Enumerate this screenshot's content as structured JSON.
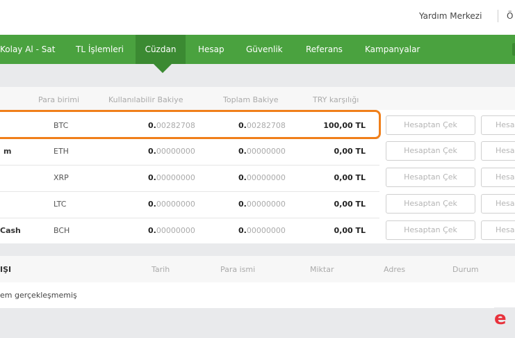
{
  "header": {
    "help_link": "Yardım Merkezi",
    "cut_link": "Ö"
  },
  "nav": {
    "items": [
      "Kolay Al - Sat",
      "TL İşlemleri",
      "Cüzdan",
      "Hesap",
      "Güvenlik",
      "Referans",
      "Kampanyalar"
    ],
    "active_index": 2
  },
  "wallet": {
    "columns": [
      "Para birimi",
      "Kullanılabilir Bakiye",
      "Toplam Bakiye",
      "TRY karşılığı"
    ],
    "rows": [
      {
        "name": "",
        "code": "BTC",
        "available_int": "0.",
        "available_dec": "00282708",
        "total_int": "0.",
        "total_dec": "00282708",
        "try": "100,00 TL"
      },
      {
        "name": "m",
        "code": "ETH",
        "available_int": "0.",
        "available_dec": "00000000",
        "total_int": "0.",
        "total_dec": "00000000",
        "try": "0,00 TL"
      },
      {
        "name": "",
        "code": "XRP",
        "available_int": "0.",
        "available_dec": "00000000",
        "total_int": "0.",
        "total_dec": "00000000",
        "try": "0,00 TL"
      },
      {
        "name": "",
        "code": "LTC",
        "available_int": "0.",
        "available_dec": "00000000",
        "total_int": "0.",
        "total_dec": "00000000",
        "try": "0,00 TL"
      },
      {
        "name": "Cash",
        "code": "BCH",
        "available_int": "0.",
        "available_dec": "00000000",
        "total_int": "0.",
        "total_dec": "00000000",
        "try": "0,00 TL"
      }
    ],
    "withdraw_label": "Hesaptan Çek",
    "second_button_label": "Hesa"
  },
  "history": {
    "title": "IŞI",
    "columns": [
      "Tarih",
      "Para ismi",
      "Miktar",
      "Adres",
      "Durum"
    ],
    "empty_text": "em gerçekleşmemiş"
  },
  "logo": {
    "letter": "e",
    "color": "#e8323c"
  },
  "colors": {
    "nav_green": "#4aa23f",
    "nav_active": "#3b8a32",
    "highlight": "#f07f1a"
  }
}
